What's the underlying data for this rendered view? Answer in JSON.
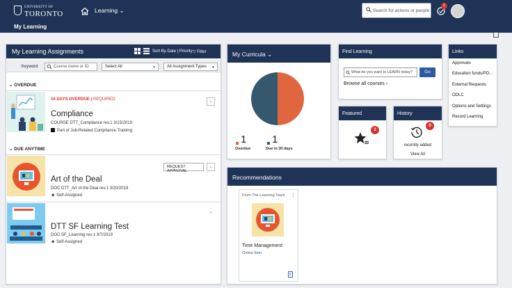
{
  "header": {
    "logo_line1": "UNIVERSITY OF",
    "logo_line2": "TORONTO",
    "learning_menu": "Learning",
    "section_title": "My Learning",
    "search_placeholder": "Search for actions or people",
    "todo_count": "1"
  },
  "assignments": {
    "title": "My Learning Assignments",
    "sort_label": "Sort By Date | Priority",
    "filter_label": "Filter",
    "keyword_label": "Keyword",
    "keyword_placeholder": "Course name or ID",
    "select_all": "Select All",
    "type_filter": "All Assignment Types",
    "sections": {
      "overdue": "OVERDUE",
      "due_anytime": "DUE ANYTIME"
    },
    "items": [
      {
        "status_overdue": "16 DAYS OVERDUE",
        "status_required": "REQUIRED",
        "title": "Compliance",
        "meta": "COURSE DTT_Compliance rev.1 3/15/2019",
        "program": "Part of Job-Related Compliance Training"
      },
      {
        "action": "REQUEST APPROVAL",
        "title": "Art of the Deal",
        "meta": "DOC DTT_Art of the Deal rev.1 3/20/2019",
        "assigned": "Self-Assigned"
      },
      {
        "title": "DTT SF Learning Test",
        "meta": "DOC SF_Learning rev.1 3/7/2019",
        "assigned": "Self-Assigned"
      }
    ]
  },
  "curricula": {
    "title": "My Curricula",
    "overdue_count": "1",
    "overdue_label": "Overdue",
    "due_count": "1",
    "due_label": "Due in 30 days",
    "colors": {
      "overdue": "#e06640",
      "due": "#35586e"
    }
  },
  "find_learning": {
    "title": "Find Learning",
    "placeholder": "What do you want to LEARN today?",
    "go": "Go",
    "browse": "Browse all courses"
  },
  "featured": {
    "title": "Featured",
    "badge": "2"
  },
  "history": {
    "title": "History",
    "badge": "0",
    "caption": "recently added",
    "view_all": "View All"
  },
  "links": {
    "title": "Links",
    "items": [
      "Approvals",
      "Education funds/PD...",
      "External Requests",
      "ODLC",
      "Options and Settings",
      "Record Learning"
    ]
  },
  "recommendations": {
    "title": "Recommendations",
    "source": "From The Learning Team",
    "item_title": "Time Management",
    "item_type": "Online Item"
  },
  "colors": {
    "navy": "#1e3356",
    "red": "#d9342b",
    "blue_button": "#2b5aa0"
  }
}
